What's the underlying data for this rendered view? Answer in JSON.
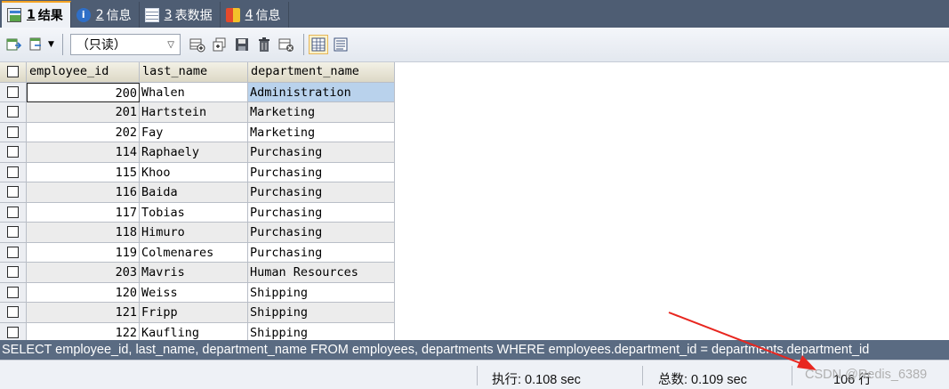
{
  "tabs": [
    {
      "num": "1",
      "label": "结果",
      "icon": "result-grid-icon",
      "active": true
    },
    {
      "num": "2",
      "label": "信息",
      "icon": "info-icon",
      "active": false
    },
    {
      "num": "3",
      "label": "表数据",
      "icon": "table-data-icon",
      "active": false
    },
    {
      "num": "4",
      "label": "信息",
      "icon": "info-chart-icon",
      "active": false
    }
  ],
  "toolbar": {
    "mode_select": "（只读）",
    "icons": [
      "export-icon",
      "import-icon",
      "insert-row-icon",
      "duplicate-row-icon",
      "save-icon",
      "delete-icon",
      "refresh-icon",
      "grid-view-icon",
      "text-view-icon"
    ]
  },
  "grid": {
    "columns": [
      "employee_id",
      "last_name",
      "department_name"
    ],
    "rows": [
      [
        "200",
        "Whalen",
        "Administration"
      ],
      [
        "201",
        "Hartstein",
        "Marketing"
      ],
      [
        "202",
        "Fay",
        "Marketing"
      ],
      [
        "114",
        "Raphaely",
        "Purchasing"
      ],
      [
        "115",
        "Khoo",
        "Purchasing"
      ],
      [
        "116",
        "Baida",
        "Purchasing"
      ],
      [
        "117",
        "Tobias",
        "Purchasing"
      ],
      [
        "118",
        "Himuro",
        "Purchasing"
      ],
      [
        "119",
        "Colmenares",
        "Purchasing"
      ],
      [
        "203",
        "Mavris",
        "Human Resources"
      ],
      [
        "120",
        "Weiss",
        "Shipping"
      ],
      [
        "121",
        "Fripp",
        "Shipping"
      ],
      [
        "122",
        "Kaufling",
        "Shipping"
      ]
    ]
  },
  "sql": "SELECT employee_id, last_name, department_name FROM employees, departments WHERE employees.department_id = departments.department_id",
  "status": {
    "exec_label": "执行: 0.108 sec",
    "total_label": "总数: 0.109 sec",
    "rows_label": "106 行"
  },
  "watermark": "CSDN @Redis_6389",
  "colors": {
    "accent_tab": "#f4a324",
    "selection": "#b9d2ec",
    "annotation_arrow": "#e8261f"
  }
}
